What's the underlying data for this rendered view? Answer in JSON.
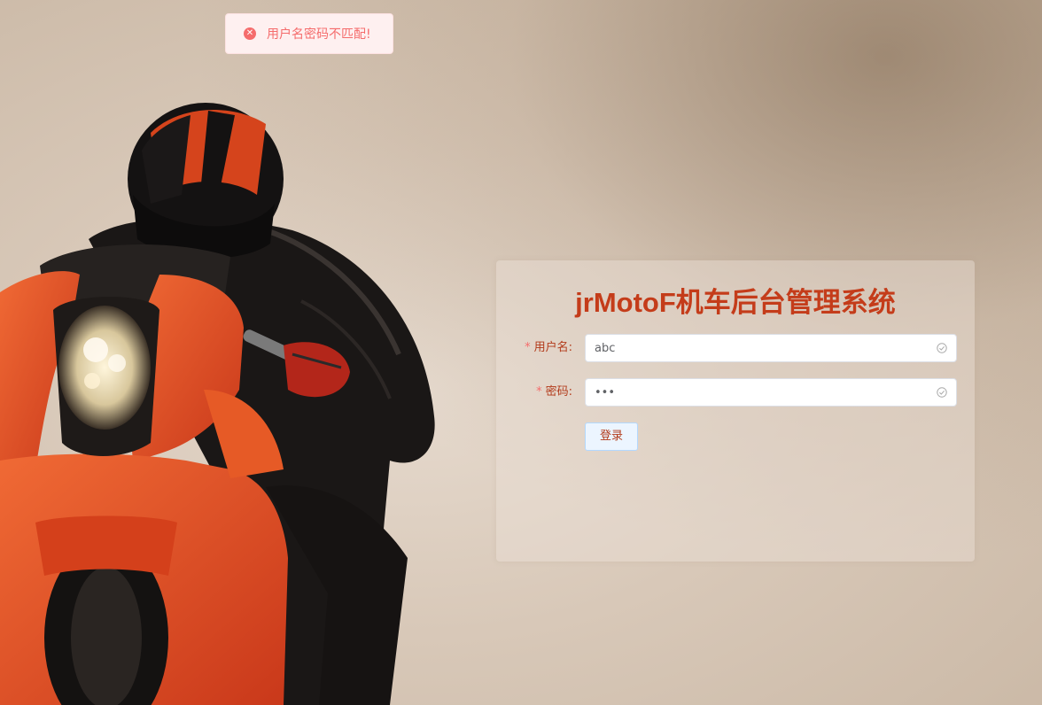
{
  "toast": {
    "icon": "error-circle-icon",
    "message": "用户名密码不匹配!"
  },
  "login": {
    "title": "jrMotoF机车后台管理系统",
    "username_label": "用户名:",
    "username_value": "abc",
    "password_label": "密码:",
    "password_value": "abc",
    "required_mark": "*",
    "login_button": "登录",
    "valid_icon": "check-circle-icon"
  },
  "colors": {
    "title": "#c43c1a",
    "toast_text": "#f56c6c",
    "toast_bg": "#fef0f0",
    "bike_orange": "#e0471b"
  }
}
